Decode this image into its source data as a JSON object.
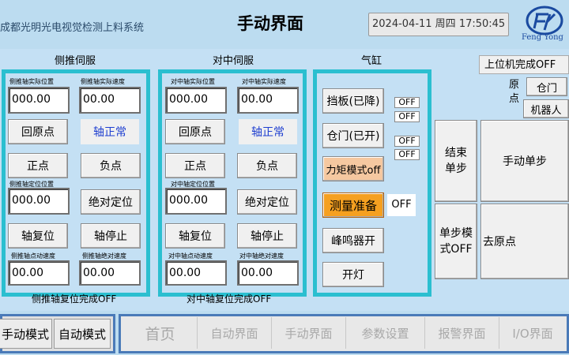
{
  "header": {
    "system_name": "成都光明光电视觉检测上料系统",
    "page_title": "手动界面",
    "datetime": "2024-04-11 周四 17:50:45",
    "logo_text": "Feng Yong"
  },
  "side_servo": {
    "title": "侧推伺服",
    "actual_pos_label": "侧推轴实际位置",
    "actual_pos_value": "000.00",
    "actual_speed_label": "侧推轴实际速度",
    "actual_speed_value": "00.00",
    "home_btn": "回原点",
    "axis_status": "轴正常",
    "positive_btn": "正点",
    "negative_btn": "负点",
    "set_pos_label": "侧推轴定位位置",
    "set_pos_value": "000.00",
    "abs_pos_btn": "绝对定位",
    "reset_btn": "轴复位",
    "stop_btn": "轴停止",
    "jog_speed_label": "侧推轴点动速度",
    "jog_speed_value": "00.00",
    "abs_speed_label": "侧推轴绝对速度",
    "abs_speed_value": "00.00",
    "reset_done": "侧推轴复位完成OFF"
  },
  "center_servo": {
    "title": "对中伺服",
    "actual_pos_label": "对中轴实际位置",
    "actual_pos_value": "000.00",
    "actual_speed_label": "对中轴实际速度",
    "actual_speed_value": "00.00",
    "home_btn": "回原点",
    "axis_status": "轴正常",
    "positive_btn": "正点",
    "negative_btn": "负点",
    "set_pos_label": "对中轴定位位置",
    "set_pos_value": "000.00",
    "abs_pos_btn": "绝对定位",
    "reset_btn": "轴复位",
    "stop_btn": "轴停止",
    "jog_speed_label": "对中轴点动速度",
    "jog_speed_value": "00.00",
    "abs_speed_label": "对中轴绝对速度",
    "abs_speed_value": "00.00",
    "reset_done": "对中轴复位完成OFF"
  },
  "cylinder": {
    "title": "气缸",
    "baffle_btn": "挡板(已降)",
    "baffle_off_1": "OFF",
    "baffle_off_2": "OFF",
    "door_btn": "仓门(已开)",
    "door_off_1": "OFF",
    "door_off_2": "OFF",
    "torque_btn": "力矩模式off",
    "measure_btn": "测量准备",
    "measure_state": "OFF",
    "buzzer_btn": "峰鸣器开",
    "light_btn": "开灯"
  },
  "right_panel": {
    "host_done": "上位机完成OFF",
    "origin_label_1": "原",
    "origin_label_2": "点",
    "door_btn": "仓门",
    "robot_btn": "机器人",
    "end_step_btn": "结束单步",
    "manual_step_btn": "手动单步",
    "step_mode_btn": "单步模式OFF",
    "go_origin_btn": "去原点"
  },
  "nav": {
    "manual_mode": "手动模式",
    "auto_mode": "自动模式",
    "items": [
      "首页",
      "自动界面",
      "手动界面",
      "参数设置",
      "报警界面",
      "I/O界面"
    ]
  },
  "colors": {
    "panel_border": "#2bbfd0",
    "accent_orange": "#f5a020",
    "status_blue": "#1f3fd0"
  }
}
